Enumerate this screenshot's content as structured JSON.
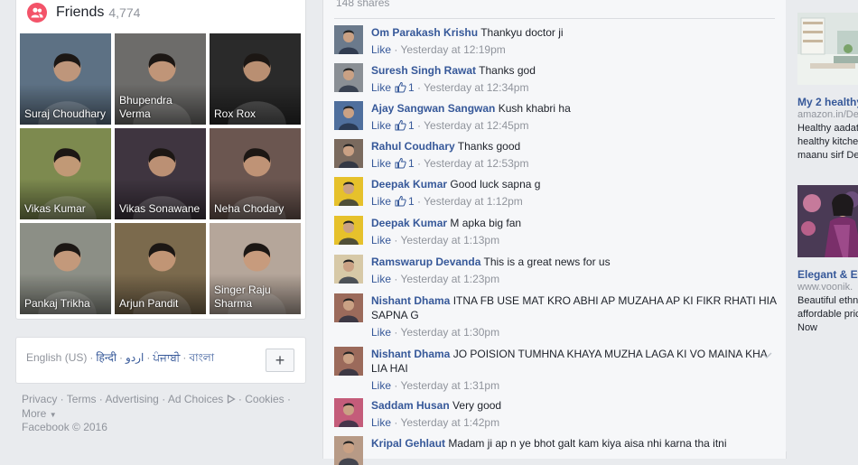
{
  "friends": {
    "title": "Friends",
    "count": "4,774",
    "tiles": [
      {
        "name": "Suraj Choudhary",
        "bg": "#5d7184"
      },
      {
        "name": "Bhupendra Verma",
        "bg": "#6d6c6a"
      },
      {
        "name": "Rox Rox",
        "bg": "#2a2a2a"
      },
      {
        "name": "Vikas Kumar",
        "bg": "#7d8a4f"
      },
      {
        "name": "Vikas Sonawane",
        "bg": "#3f3540"
      },
      {
        "name": "Neha Chodary",
        "bg": "#6b5650"
      },
      {
        "name": "Pankaj Trikha",
        "bg": "#8c8f86"
      },
      {
        "name": "Arjun Pandit",
        "bg": "#7b6a4d"
      },
      {
        "name": "Singer Raju Sharma",
        "bg": "#b5a69a"
      }
    ]
  },
  "languages": {
    "current": "English (US)",
    "others": [
      "हिन्दी",
      "اردو",
      "ਪੰਜਾਬੀ",
      "বাংলা"
    ],
    "add_label": "+"
  },
  "footer": {
    "links": [
      "Privacy",
      "Terms",
      "Advertising",
      "Ad Choices",
      "Cookies",
      "More"
    ],
    "copyright": "Facebook © 2016"
  },
  "feed": {
    "shares": "148 shares",
    "like_label": "Like",
    "comments": [
      {
        "author": "Om Parakash Krishu",
        "text": "Thankyu doctor ji",
        "likes": "",
        "time": "Yesterday at 12:19pm"
      },
      {
        "author": "Suresh Singh Rawat",
        "text": "Thanks god",
        "likes": "1",
        "time": "Yesterday at 12:34pm"
      },
      {
        "author": "Ajay Sangwan Sangwan",
        "text": "Kush khabri ha",
        "likes": "1",
        "time": "Yesterday at 12:45pm"
      },
      {
        "author": "Rahul Coudhary",
        "text": "Thanks good",
        "likes": "1",
        "time": "Yesterday at 12:53pm"
      },
      {
        "author": "Deepak Kumar",
        "text": "Good luck sapna g",
        "likes": "1",
        "time": "Yesterday at 1:12pm"
      },
      {
        "author": "Deepak Kumar",
        "text": "M apka big fan",
        "likes": "",
        "time": "Yesterday at 1:13pm"
      },
      {
        "author": "Ramswarup Devanda",
        "text": "This is a great news for us",
        "likes": "",
        "time": "Yesterday at 1:23pm"
      },
      {
        "author": "Nishant Dhama",
        "text": "ITNA FB USE MAT KRO ABHI AP MUZAHA AP KI FIKR RHATI HIA SAPNA G",
        "likes": "",
        "time": "Yesterday at 1:30pm"
      },
      {
        "author": "Nishant Dhama",
        "text": "JO POISION TUMHNA KHAYA MUZHA LAGA KI VO MAINA KHA LIA HAI",
        "likes": "",
        "time": "Yesterday at 1:31pm"
      },
      {
        "author": "Saddam Husan",
        "text": "Very good",
        "likes": "",
        "time": "Yesterday at 1:42pm"
      },
      {
        "author": "Kripal Gehlaut",
        "text": "Madam ji ap n ye bhot galt kam kiya aisa nhi karna tha itni",
        "likes": "",
        "time": ""
      }
    ]
  },
  "ads": [
    {
      "title": "My 2 healthy",
      "domain": "amazon.in/Det",
      "lines": [
        "Healthy aadat",
        "healthy kitche",
        "maanu sirf De"
      ]
    },
    {
      "title": "Elegant & Eve",
      "domain": "www.voonik.",
      "lines": [
        "Beautiful ethn",
        "affordable pric",
        "Now"
      ]
    }
  ]
}
